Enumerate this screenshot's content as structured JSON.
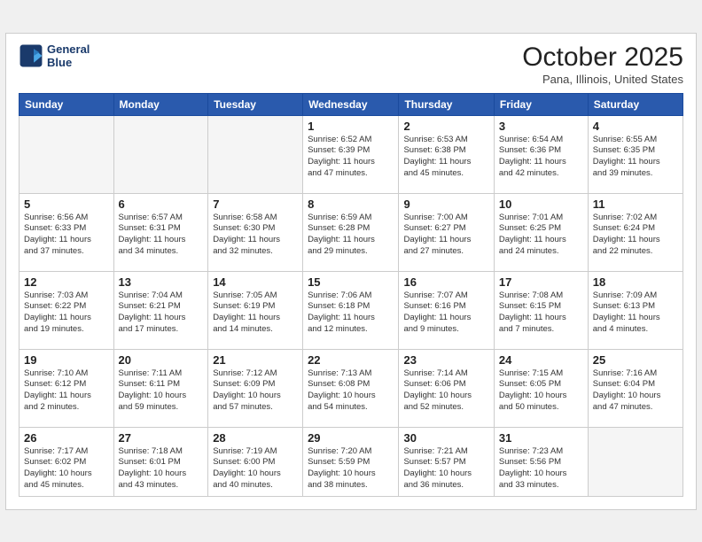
{
  "header": {
    "logo_line1": "General",
    "logo_line2": "Blue",
    "month": "October 2025",
    "location": "Pana, Illinois, United States"
  },
  "weekdays": [
    "Sunday",
    "Monday",
    "Tuesday",
    "Wednesday",
    "Thursday",
    "Friday",
    "Saturday"
  ],
  "weeks": [
    [
      {
        "day": "",
        "info": ""
      },
      {
        "day": "",
        "info": ""
      },
      {
        "day": "",
        "info": ""
      },
      {
        "day": "1",
        "info": "Sunrise: 6:52 AM\nSunset: 6:39 PM\nDaylight: 11 hours\nand 47 minutes."
      },
      {
        "day": "2",
        "info": "Sunrise: 6:53 AM\nSunset: 6:38 PM\nDaylight: 11 hours\nand 45 minutes."
      },
      {
        "day": "3",
        "info": "Sunrise: 6:54 AM\nSunset: 6:36 PM\nDaylight: 11 hours\nand 42 minutes."
      },
      {
        "day": "4",
        "info": "Sunrise: 6:55 AM\nSunset: 6:35 PM\nDaylight: 11 hours\nand 39 minutes."
      }
    ],
    [
      {
        "day": "5",
        "info": "Sunrise: 6:56 AM\nSunset: 6:33 PM\nDaylight: 11 hours\nand 37 minutes."
      },
      {
        "day": "6",
        "info": "Sunrise: 6:57 AM\nSunset: 6:31 PM\nDaylight: 11 hours\nand 34 minutes."
      },
      {
        "day": "7",
        "info": "Sunrise: 6:58 AM\nSunset: 6:30 PM\nDaylight: 11 hours\nand 32 minutes."
      },
      {
        "day": "8",
        "info": "Sunrise: 6:59 AM\nSunset: 6:28 PM\nDaylight: 11 hours\nand 29 minutes."
      },
      {
        "day": "9",
        "info": "Sunrise: 7:00 AM\nSunset: 6:27 PM\nDaylight: 11 hours\nand 27 minutes."
      },
      {
        "day": "10",
        "info": "Sunrise: 7:01 AM\nSunset: 6:25 PM\nDaylight: 11 hours\nand 24 minutes."
      },
      {
        "day": "11",
        "info": "Sunrise: 7:02 AM\nSunset: 6:24 PM\nDaylight: 11 hours\nand 22 minutes."
      }
    ],
    [
      {
        "day": "12",
        "info": "Sunrise: 7:03 AM\nSunset: 6:22 PM\nDaylight: 11 hours\nand 19 minutes."
      },
      {
        "day": "13",
        "info": "Sunrise: 7:04 AM\nSunset: 6:21 PM\nDaylight: 11 hours\nand 17 minutes."
      },
      {
        "day": "14",
        "info": "Sunrise: 7:05 AM\nSunset: 6:19 PM\nDaylight: 11 hours\nand 14 minutes."
      },
      {
        "day": "15",
        "info": "Sunrise: 7:06 AM\nSunset: 6:18 PM\nDaylight: 11 hours\nand 12 minutes."
      },
      {
        "day": "16",
        "info": "Sunrise: 7:07 AM\nSunset: 6:16 PM\nDaylight: 11 hours\nand 9 minutes."
      },
      {
        "day": "17",
        "info": "Sunrise: 7:08 AM\nSunset: 6:15 PM\nDaylight: 11 hours\nand 7 minutes."
      },
      {
        "day": "18",
        "info": "Sunrise: 7:09 AM\nSunset: 6:13 PM\nDaylight: 11 hours\nand 4 minutes."
      }
    ],
    [
      {
        "day": "19",
        "info": "Sunrise: 7:10 AM\nSunset: 6:12 PM\nDaylight: 11 hours\nand 2 minutes."
      },
      {
        "day": "20",
        "info": "Sunrise: 7:11 AM\nSunset: 6:11 PM\nDaylight: 10 hours\nand 59 minutes."
      },
      {
        "day": "21",
        "info": "Sunrise: 7:12 AM\nSunset: 6:09 PM\nDaylight: 10 hours\nand 57 minutes."
      },
      {
        "day": "22",
        "info": "Sunrise: 7:13 AM\nSunset: 6:08 PM\nDaylight: 10 hours\nand 54 minutes."
      },
      {
        "day": "23",
        "info": "Sunrise: 7:14 AM\nSunset: 6:06 PM\nDaylight: 10 hours\nand 52 minutes."
      },
      {
        "day": "24",
        "info": "Sunrise: 7:15 AM\nSunset: 6:05 PM\nDaylight: 10 hours\nand 50 minutes."
      },
      {
        "day": "25",
        "info": "Sunrise: 7:16 AM\nSunset: 6:04 PM\nDaylight: 10 hours\nand 47 minutes."
      }
    ],
    [
      {
        "day": "26",
        "info": "Sunrise: 7:17 AM\nSunset: 6:02 PM\nDaylight: 10 hours\nand 45 minutes."
      },
      {
        "day": "27",
        "info": "Sunrise: 7:18 AM\nSunset: 6:01 PM\nDaylight: 10 hours\nand 43 minutes."
      },
      {
        "day": "28",
        "info": "Sunrise: 7:19 AM\nSunset: 6:00 PM\nDaylight: 10 hours\nand 40 minutes."
      },
      {
        "day": "29",
        "info": "Sunrise: 7:20 AM\nSunset: 5:59 PM\nDaylight: 10 hours\nand 38 minutes."
      },
      {
        "day": "30",
        "info": "Sunrise: 7:21 AM\nSunset: 5:57 PM\nDaylight: 10 hours\nand 36 minutes."
      },
      {
        "day": "31",
        "info": "Sunrise: 7:23 AM\nSunset: 5:56 PM\nDaylight: 10 hours\nand 33 minutes."
      },
      {
        "day": "",
        "info": ""
      }
    ]
  ]
}
